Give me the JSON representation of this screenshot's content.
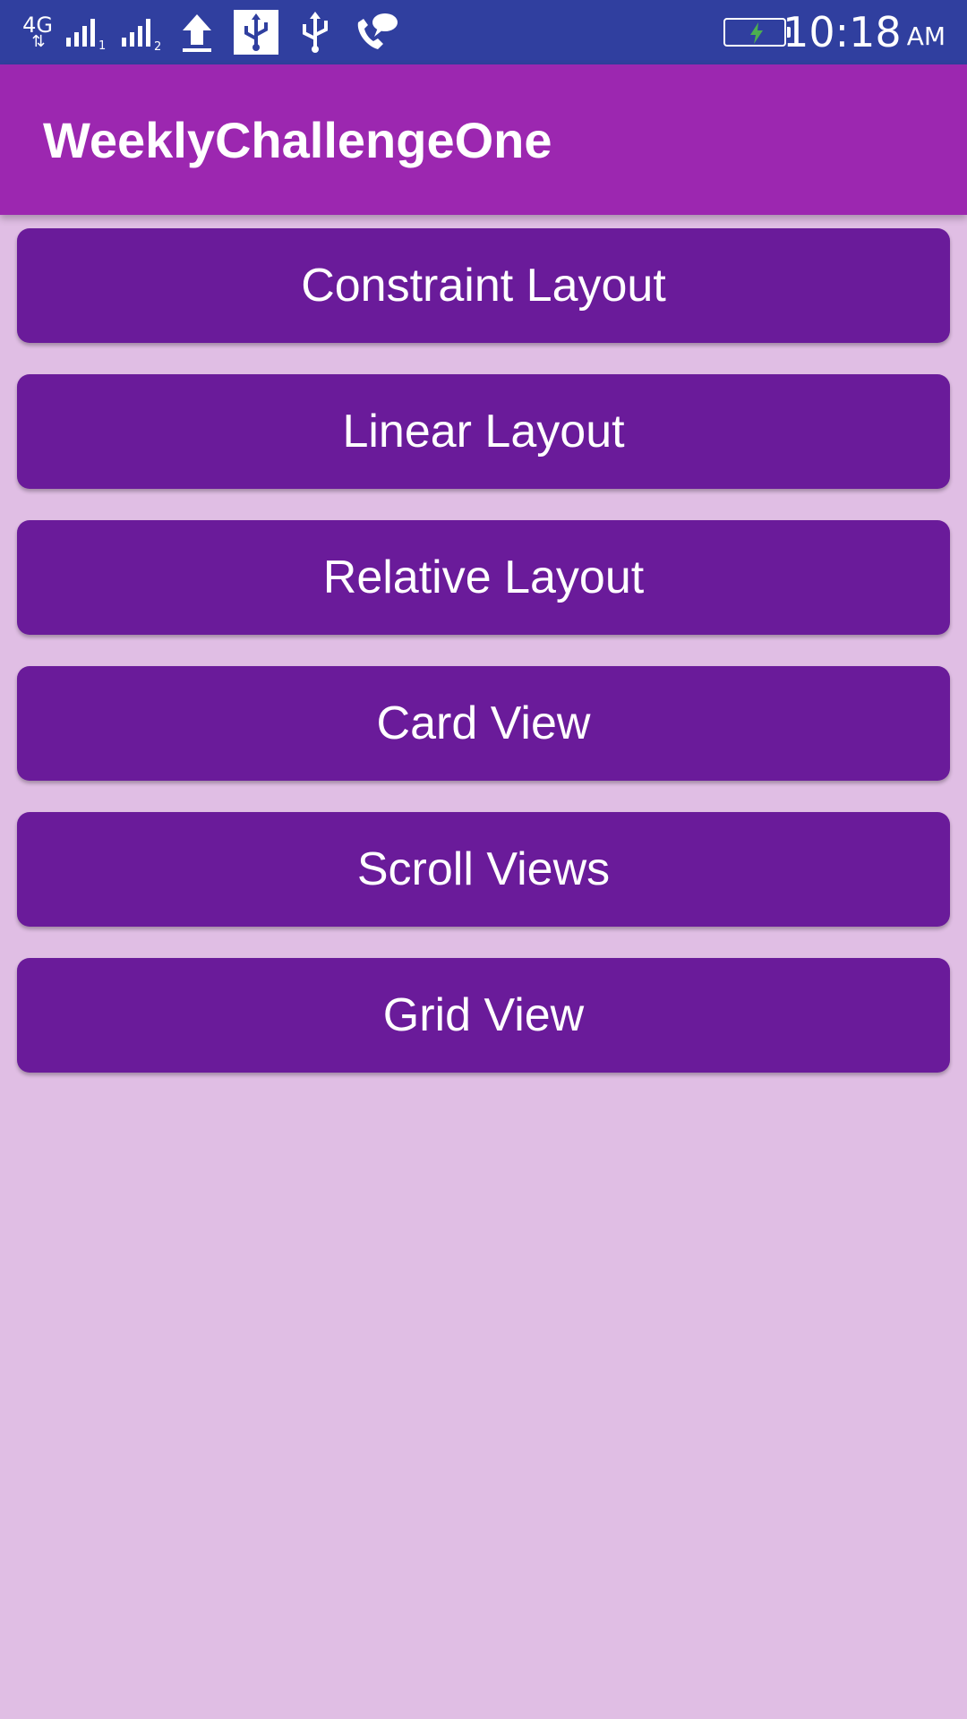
{
  "status_bar": {
    "network": "4G",
    "time": "10:18",
    "ampm": "AM",
    "icons": [
      "4g-data-icon",
      "signal-sim1-icon",
      "signal-sim2-icon",
      "upload-icon",
      "usb-debug-icon",
      "usb-icon",
      "call-message-icon",
      "battery-charging-icon"
    ]
  },
  "app_bar": {
    "title": "WeeklyChallengeOne"
  },
  "buttons": [
    {
      "label": "Constraint Layout"
    },
    {
      "label": "Linear Layout"
    },
    {
      "label": "Relative Layout"
    },
    {
      "label": "Card View"
    },
    {
      "label": "Scroll Views"
    },
    {
      "label": "Grid View"
    }
  ],
  "colors": {
    "status_bar": "#303f9f",
    "app_bar": "#9c27b0",
    "button": "#6a1b9a",
    "background": "#e0bee4",
    "battery_bolt": "#4caf50"
  }
}
